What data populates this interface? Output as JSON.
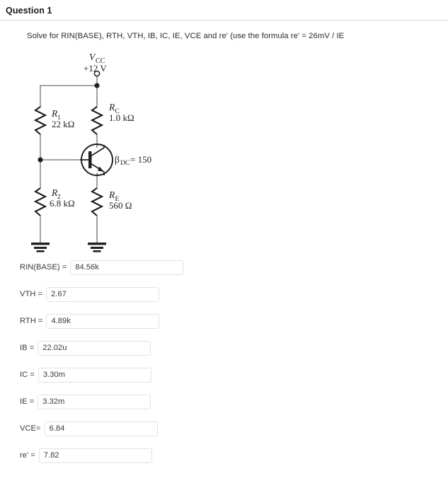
{
  "header": {
    "title": "Question 1"
  },
  "prompt": {
    "text": "Solve for  RIN(BASE), RTH, VTH, IB, IC, IE, VCE and re' (use the formula re' = 26mV / IE"
  },
  "circuit": {
    "supply": {
      "symbol": "V",
      "subscript": "CC",
      "value": "+12 V"
    },
    "components": [
      {
        "id": "r1",
        "name": "R",
        "subscript": "1",
        "value": "22 kΩ"
      },
      {
        "id": "rc",
        "name": "R",
        "subscript": "C",
        "value": "1.0 kΩ"
      },
      {
        "id": "r2",
        "name": "R",
        "subscript": "2",
        "value": "6.8 kΩ"
      },
      {
        "id": "re",
        "name": "R",
        "subscript": "E",
        "value": "560 Ω"
      }
    ],
    "transistor": {
      "type": "npn",
      "beta_symbol": "β",
      "beta_subscript": "DC",
      "beta_eq": "= 150",
      "beta_value": "150"
    },
    "ink_color": "#1a1a1a",
    "wire_color": "#808080"
  },
  "fields": [
    {
      "id": "rin-base",
      "label": "RIN(BASE) =",
      "value": "84.56k",
      "placeholder": ""
    },
    {
      "id": "vth",
      "label": "VTH =",
      "value": "2.67",
      "placeholder": ""
    },
    {
      "id": "rth",
      "label": "RTH =",
      "value": "4.89k",
      "placeholder": ""
    },
    {
      "id": "ib",
      "label": "IB =",
      "value": "22.02u",
      "placeholder": ""
    },
    {
      "id": "ic",
      "label": "IC =",
      "value": "3.30m",
      "placeholder": ""
    },
    {
      "id": "ie",
      "label": "IE =",
      "value": "3.32m",
      "placeholder": ""
    },
    {
      "id": "vce",
      "label": "VCE=",
      "value": "6.84",
      "placeholder": ""
    },
    {
      "id": "re",
      "label": "re' =",
      "value": "7.82",
      "placeholder": ""
    }
  ]
}
